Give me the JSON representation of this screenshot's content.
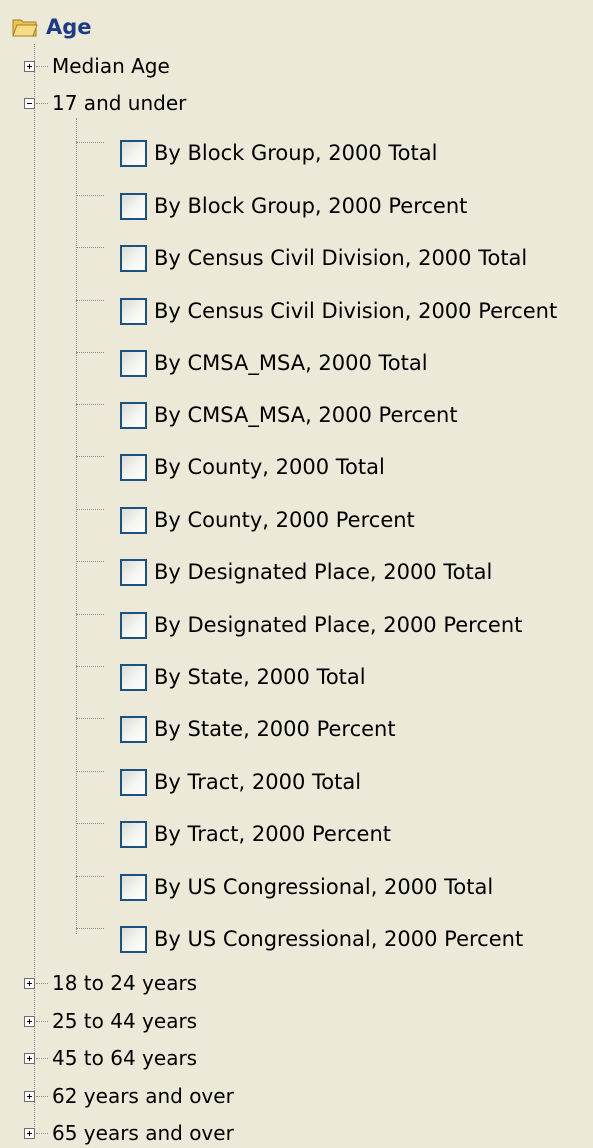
{
  "tree": {
    "root": {
      "label": "Age",
      "icon": "folder-open-icon"
    },
    "median_age": {
      "label": "Median Age",
      "expanded": false
    },
    "under17": {
      "label": "17 and under",
      "expanded": true,
      "children": [
        "By Block Group, 2000 Total",
        "By Block Group, 2000 Percent",
        "By Census Civil Division, 2000 Total",
        "By Census Civil Division, 2000 Percent",
        "By CMSA_MSA, 2000 Total",
        "By CMSA_MSA, 2000 Percent",
        "By County, 2000 Total",
        "By County, 2000 Percent",
        "By Designated Place, 2000 Total",
        "By Designated Place, 2000 Percent",
        "By State, 2000 Total",
        "By State, 2000 Percent",
        "By Tract, 2000 Total",
        "By Tract, 2000 Percent",
        "By US Congressional, 2000 Total",
        "By US Congressional, 2000 Percent"
      ]
    },
    "more": [
      "18 to 24 years",
      "25 to 44 years",
      "45 to 64 years",
      "62 years and over",
      "65 years and over"
    ]
  },
  "colors": {
    "background": "#ece9d8",
    "root_label": "#1f3b87",
    "checkbox_border": "#1c5180"
  }
}
